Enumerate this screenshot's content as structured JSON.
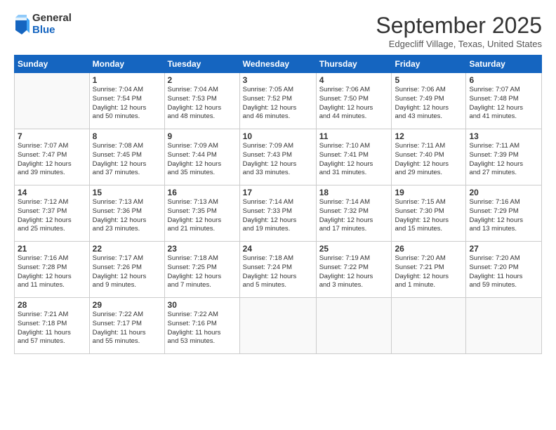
{
  "header": {
    "logo_general": "General",
    "logo_blue": "Blue",
    "month_title": "September 2025",
    "subtitle": "Edgecliff Village, Texas, United States"
  },
  "weekdays": [
    "Sunday",
    "Monday",
    "Tuesday",
    "Wednesday",
    "Thursday",
    "Friday",
    "Saturday"
  ],
  "weeks": [
    [
      {
        "day": "",
        "info": ""
      },
      {
        "day": "1",
        "info": "Sunrise: 7:04 AM\nSunset: 7:54 PM\nDaylight: 12 hours\nand 50 minutes."
      },
      {
        "day": "2",
        "info": "Sunrise: 7:04 AM\nSunset: 7:53 PM\nDaylight: 12 hours\nand 48 minutes."
      },
      {
        "day": "3",
        "info": "Sunrise: 7:05 AM\nSunset: 7:52 PM\nDaylight: 12 hours\nand 46 minutes."
      },
      {
        "day": "4",
        "info": "Sunrise: 7:06 AM\nSunset: 7:50 PM\nDaylight: 12 hours\nand 44 minutes."
      },
      {
        "day": "5",
        "info": "Sunrise: 7:06 AM\nSunset: 7:49 PM\nDaylight: 12 hours\nand 43 minutes."
      },
      {
        "day": "6",
        "info": "Sunrise: 7:07 AM\nSunset: 7:48 PM\nDaylight: 12 hours\nand 41 minutes."
      }
    ],
    [
      {
        "day": "7",
        "info": "Sunrise: 7:07 AM\nSunset: 7:47 PM\nDaylight: 12 hours\nand 39 minutes."
      },
      {
        "day": "8",
        "info": "Sunrise: 7:08 AM\nSunset: 7:45 PM\nDaylight: 12 hours\nand 37 minutes."
      },
      {
        "day": "9",
        "info": "Sunrise: 7:09 AM\nSunset: 7:44 PM\nDaylight: 12 hours\nand 35 minutes."
      },
      {
        "day": "10",
        "info": "Sunrise: 7:09 AM\nSunset: 7:43 PM\nDaylight: 12 hours\nand 33 minutes."
      },
      {
        "day": "11",
        "info": "Sunrise: 7:10 AM\nSunset: 7:41 PM\nDaylight: 12 hours\nand 31 minutes."
      },
      {
        "day": "12",
        "info": "Sunrise: 7:11 AM\nSunset: 7:40 PM\nDaylight: 12 hours\nand 29 minutes."
      },
      {
        "day": "13",
        "info": "Sunrise: 7:11 AM\nSunset: 7:39 PM\nDaylight: 12 hours\nand 27 minutes."
      }
    ],
    [
      {
        "day": "14",
        "info": "Sunrise: 7:12 AM\nSunset: 7:37 PM\nDaylight: 12 hours\nand 25 minutes."
      },
      {
        "day": "15",
        "info": "Sunrise: 7:13 AM\nSunset: 7:36 PM\nDaylight: 12 hours\nand 23 minutes."
      },
      {
        "day": "16",
        "info": "Sunrise: 7:13 AM\nSunset: 7:35 PM\nDaylight: 12 hours\nand 21 minutes."
      },
      {
        "day": "17",
        "info": "Sunrise: 7:14 AM\nSunset: 7:33 PM\nDaylight: 12 hours\nand 19 minutes."
      },
      {
        "day": "18",
        "info": "Sunrise: 7:14 AM\nSunset: 7:32 PM\nDaylight: 12 hours\nand 17 minutes."
      },
      {
        "day": "19",
        "info": "Sunrise: 7:15 AM\nSunset: 7:30 PM\nDaylight: 12 hours\nand 15 minutes."
      },
      {
        "day": "20",
        "info": "Sunrise: 7:16 AM\nSunset: 7:29 PM\nDaylight: 12 hours\nand 13 minutes."
      }
    ],
    [
      {
        "day": "21",
        "info": "Sunrise: 7:16 AM\nSunset: 7:28 PM\nDaylight: 12 hours\nand 11 minutes."
      },
      {
        "day": "22",
        "info": "Sunrise: 7:17 AM\nSunset: 7:26 PM\nDaylight: 12 hours\nand 9 minutes."
      },
      {
        "day": "23",
        "info": "Sunrise: 7:18 AM\nSunset: 7:25 PM\nDaylight: 12 hours\nand 7 minutes."
      },
      {
        "day": "24",
        "info": "Sunrise: 7:18 AM\nSunset: 7:24 PM\nDaylight: 12 hours\nand 5 minutes."
      },
      {
        "day": "25",
        "info": "Sunrise: 7:19 AM\nSunset: 7:22 PM\nDaylight: 12 hours\nand 3 minutes."
      },
      {
        "day": "26",
        "info": "Sunrise: 7:20 AM\nSunset: 7:21 PM\nDaylight: 12 hours\nand 1 minute."
      },
      {
        "day": "27",
        "info": "Sunrise: 7:20 AM\nSunset: 7:20 PM\nDaylight: 11 hours\nand 59 minutes."
      }
    ],
    [
      {
        "day": "28",
        "info": "Sunrise: 7:21 AM\nSunset: 7:18 PM\nDaylight: 11 hours\nand 57 minutes."
      },
      {
        "day": "29",
        "info": "Sunrise: 7:22 AM\nSunset: 7:17 PM\nDaylight: 11 hours\nand 55 minutes."
      },
      {
        "day": "30",
        "info": "Sunrise: 7:22 AM\nSunset: 7:16 PM\nDaylight: 11 hours\nand 53 minutes."
      },
      {
        "day": "",
        "info": ""
      },
      {
        "day": "",
        "info": ""
      },
      {
        "day": "",
        "info": ""
      },
      {
        "day": "",
        "info": ""
      }
    ]
  ]
}
